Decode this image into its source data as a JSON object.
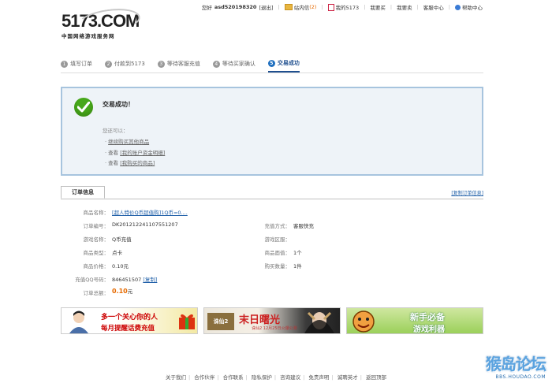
{
  "header": {
    "logo": "5173.COM",
    "logo_sub": "中国网络游戏服务网",
    "greeting": "您好",
    "username": "asd520198320",
    "logout": "[退出]",
    "inbox": "站内信",
    "inbox_count": "(2)",
    "my5173": "我的5173",
    "buy": "我要买",
    "sell": "我要卖",
    "service": "客服中心",
    "help": "帮助中心"
  },
  "steps": [
    {
      "num": "1",
      "label": "填写订单"
    },
    {
      "num": "2",
      "label": "付款到5173"
    },
    {
      "num": "3",
      "label": "等待客服充值"
    },
    {
      "num": "4",
      "label": "等待买家确认"
    },
    {
      "num": "5",
      "label": "交易成功"
    }
  ],
  "success": {
    "title": "交易成功！",
    "you_can": "您还可以：",
    "opts": [
      {
        "prefix": "· ",
        "link": "继续购买其他商品"
      },
      {
        "prefix": "· 查看 ",
        "link": "[我的账户资金明细]"
      },
      {
        "prefix": "· 查看 ",
        "link": "[我购买的商品]"
      }
    ]
  },
  "order": {
    "tab": "订单信息",
    "copy_all": "[复制订单信息]",
    "product_name_label": "商品名称：",
    "product_name": "[超人特价Q币超值购]1Q币=0....",
    "order_no_label": "订单编号：",
    "order_no": "DK201212241107551207",
    "recharge_method_label": "充值方式：",
    "recharge_method": "客服快充",
    "game_label": "游戏名称：",
    "game": "Q币充值",
    "zone_label": "游戏区服：",
    "zone": "",
    "type_label": "商品类型：",
    "type": "点卡",
    "face_label": "商品面值：",
    "face": "1个",
    "price_label": "商品价格：",
    "price": "0.10元",
    "qty_label": "购买数量：",
    "qty": "1件",
    "qq_label": "充值QQ号码：",
    "qq": "846451507",
    "qq_copy": "[复制]",
    "total_label": "订单总额：",
    "total": "0.10",
    "total_unit": "元"
  },
  "banners": [
    {
      "line1": "多一个关心你的人",
      "line2": "每月提醒话费充值"
    },
    {
      "line1": "末日曙光",
      "line2": "诛仙2 12月25日火爆公测"
    },
    {
      "line1": "新手必备",
      "line2": "游戏利器"
    }
  ],
  "footer": [
    "关于我们",
    "合作伙伴",
    "合作联系",
    "隐私保护",
    "咨询建议",
    "免责声明",
    "诚聘英才",
    "返回顶部"
  ],
  "watermark": {
    "main": "猴岛论坛",
    "sub": "BBS.HOUDAO.COM"
  },
  "colors": {
    "accent": "#1f4f8f",
    "success": "#47a81a",
    "price": "#e66a00",
    "box_border": "#a7c4de"
  }
}
